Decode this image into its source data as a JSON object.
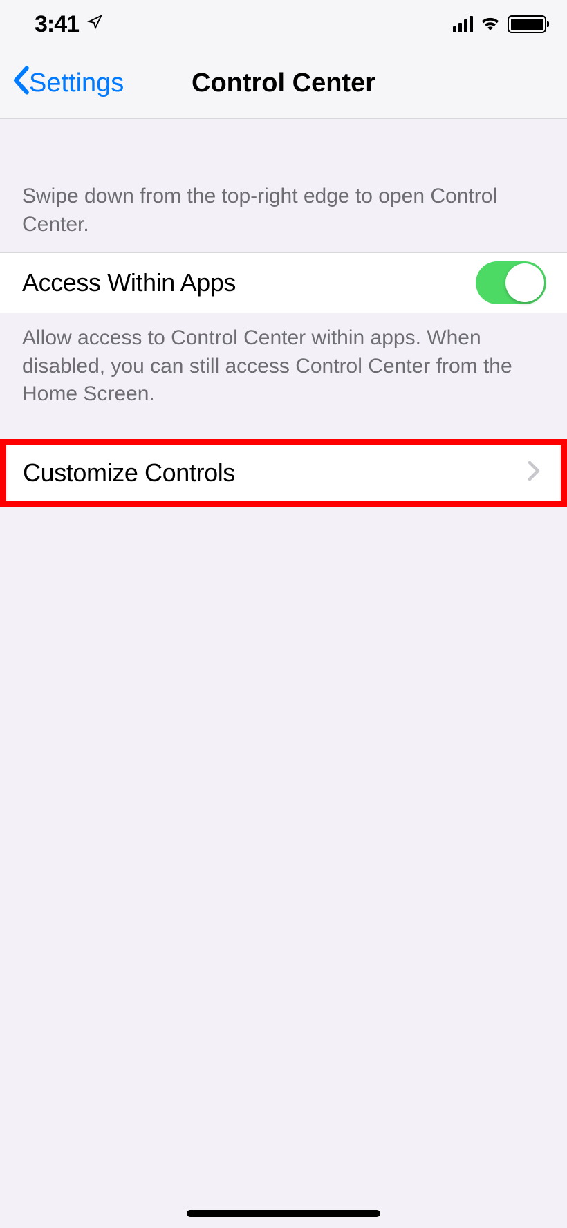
{
  "status_bar": {
    "time": "3:41"
  },
  "nav": {
    "back_label": "Settings",
    "title": "Control Center"
  },
  "section1": {
    "desc": "Swipe down from the top-right edge to open Control Center."
  },
  "access_row": {
    "label": "Access Within Apps",
    "enabled": true
  },
  "section2": {
    "desc": "Allow access to Control Center within apps. When disabled, you can still access Control Center from the Home Screen."
  },
  "customize_row": {
    "label": "Customize Controls"
  }
}
